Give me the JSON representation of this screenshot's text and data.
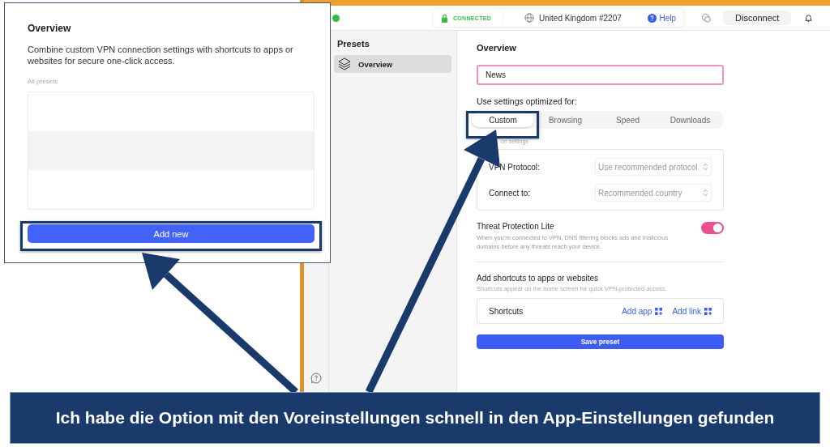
{
  "inset_panel": {
    "title": "Overview",
    "description": "Combine custom VPN connection settings with shortcuts to apps or websites for secure one-click access.",
    "list_label": "All presets",
    "add_button": "Add new"
  },
  "top_bar": {
    "status": "CONNECTED",
    "server": "United Kingdom #2207",
    "help": "Help",
    "disconnect": "Disconnect"
  },
  "sidebar": {
    "title": "Presets",
    "items": [
      {
        "label": "Overview",
        "selected": true
      }
    ]
  },
  "main": {
    "title": "Overview",
    "name_field": {
      "value": "News"
    },
    "optimize_label": "Use settings optimized for:",
    "segments": [
      {
        "label": "Custom",
        "selected": true
      },
      {
        "label": "Browsing",
        "selected": false
      },
      {
        "label": "Speed",
        "selected": false
      },
      {
        "label": "Downloads",
        "selected": false
      }
    ],
    "connection_label": "on settings",
    "settings": [
      {
        "label": "VPN Protocol:",
        "value": "Use recommended protocol"
      },
      {
        "label": "Connect to:",
        "value": "Recommended country"
      }
    ],
    "threat_protection": {
      "title": "Threat Protection Lite",
      "description": "When you're connected to VPN, DNS filtering blocks ads and malicious domains before any threats reach your device.",
      "on": true
    },
    "shortcuts_title": "Add shortcuts to apps or websites",
    "shortcuts_description": "Shortcuts appear on the home screen for quick VPN-protected access.",
    "shortcuts": {
      "label": "Shortcuts",
      "add_app": "Add app",
      "add_link": "Add link"
    },
    "save_button": "Save preset"
  },
  "caption": "Ich habe die Option mit den Voreinstellungen schnell in den App-Einstellungen gefunden"
}
